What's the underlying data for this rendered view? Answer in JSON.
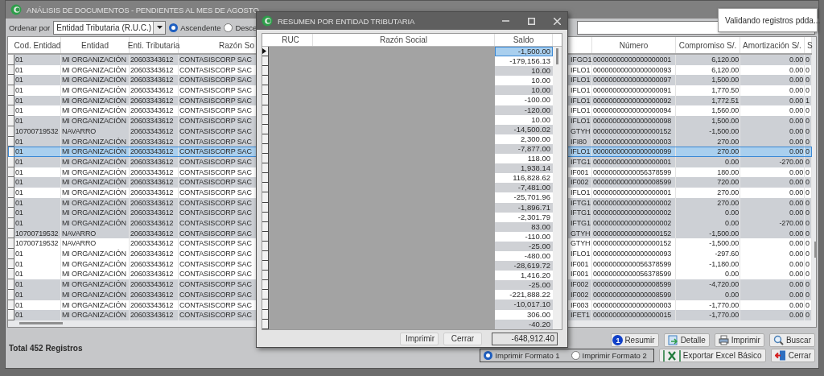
{
  "main_window": {
    "title": "ANÁLISIS DE DOCUMENTOS - PENDIENTES AL MES DE AGOSTO"
  },
  "toolbar": {
    "sort_label": "Ordenar por",
    "sort_select": {
      "value": "Entidad Tributaria (R.U.C.)"
    },
    "order_options": [
      {
        "label": "Ascendente",
        "selected": true
      },
      {
        "label": "Desce",
        "selected": false
      }
    ]
  },
  "toast": {
    "text": "Validando registros pdda..."
  },
  "grid": {
    "headers": {
      "cod_entidad": "Cod. Entidad",
      "entidad": "Entidad",
      "enti_tributaria": "Enti. Tributaria",
      "razon_social": "Razón So",
      "numero": "Número",
      "compromiso": "Compromiso S/.",
      "amortizacion": "Amortización S/.",
      "column_9": "S"
    },
    "rows": [
      {
        "cod_entidad": "01",
        "entidad": "MI ORGANIZACIÓN",
        "enti_tributaria": "20603343612",
        "razon_social": "CONTASISCORP SAC",
        "column_5": "IFGO1",
        "numero": "00000000000000000001",
        "compromiso": "6,120.00",
        "amortizacion": "0.00",
        "column_9": "0",
        "shaded": true,
        "selected": false
      },
      {
        "cod_entidad": "01",
        "entidad": "MI ORGANIZACIÓN",
        "enti_tributaria": "20603343612",
        "razon_social": "CONTASISCORP SAC",
        "column_5": "IFLO1",
        "numero": "00000000000000000093",
        "compromiso": "6,120.00",
        "amortizacion": "0.00",
        "column_9": "0",
        "shaded": false,
        "selected": false
      },
      {
        "cod_entidad": "01",
        "entidad": "MI ORGANIZACIÓN",
        "enti_tributaria": "20603343612",
        "razon_social": "CONTASISCORP SAC",
        "column_5": "IFLO1",
        "numero": "00000000000000000097",
        "compromiso": "1,500.00",
        "amortizacion": "0.00",
        "column_9": "0",
        "shaded": true,
        "selected": false
      },
      {
        "cod_entidad": "01",
        "entidad": "MI ORGANIZACIÓN",
        "enti_tributaria": "20603343612",
        "razon_social": "CONTASISCORP SAC",
        "column_5": "IFLO1",
        "numero": "00000000000000000091",
        "compromiso": "1,770.50",
        "amortizacion": "0.00",
        "column_9": "0",
        "shaded": false,
        "selected": false
      },
      {
        "cod_entidad": "01",
        "entidad": "MI ORGANIZACIÓN",
        "enti_tributaria": "20603343612",
        "razon_social": "CONTASISCORP SAC",
        "column_5": "IFLO1",
        "numero": "00000000000000000092",
        "compromiso": "1,772.51",
        "amortizacion": "0.00",
        "column_9": "1",
        "shaded": true,
        "selected": false
      },
      {
        "cod_entidad": "01",
        "entidad": "MI ORGANIZACIÓN",
        "enti_tributaria": "20603343612",
        "razon_social": "CONTASISCORP SAC",
        "column_5": "IFLO1",
        "numero": "00000000000000000094",
        "compromiso": "1,560.00",
        "amortizacion": "0.00",
        "column_9": "0",
        "shaded": false,
        "selected": false
      },
      {
        "cod_entidad": "01",
        "entidad": "MI ORGANIZACIÓN",
        "enti_tributaria": "20603343612",
        "razon_social": "CONTASISCORP SAC",
        "column_5": "IFLO1",
        "numero": "00000000000000000098",
        "compromiso": "1,500.00",
        "amortizacion": "0.00",
        "column_9": "0",
        "shaded": true,
        "selected": false
      },
      {
        "cod_entidad": "10700719532",
        "entidad": "NAVARRO",
        "enti_tributaria": "20603343612",
        "razon_social": "CONTASISCORP SAC",
        "column_5": "GTYH",
        "numero": "00000000000000000152",
        "compromiso": "-1,500.00",
        "amortizacion": "0.00",
        "column_9": "0",
        "shaded": true,
        "selected": false
      },
      {
        "cod_entidad": "01",
        "entidad": "MI ORGANIZACIÓN",
        "enti_tributaria": "20603343612",
        "razon_social": "CONTASISCORP SAC",
        "column_5": "IFI80",
        "numero": "00000000000000000003",
        "compromiso": "270.00",
        "amortizacion": "0.00",
        "column_9": "0",
        "shaded": true,
        "selected": false
      },
      {
        "cod_entidad": "01",
        "entidad": "MI ORGANIZACIÓN",
        "enti_tributaria": "20603343612",
        "razon_social": "CONTASISCORP SAC",
        "column_5": "IFLO1",
        "numero": "00000000000000000099",
        "compromiso": "270.00",
        "amortizacion": "0.00",
        "column_9": "0",
        "shaded": false,
        "selected": true
      },
      {
        "cod_entidad": "01",
        "entidad": "MI ORGANIZACIÓN",
        "enti_tributaria": "20603343612",
        "razon_social": "CONTASISCORP SAC",
        "column_5": "IFTG1",
        "numero": "00000000000000000001",
        "compromiso": "0.00",
        "amortizacion": "-270.00",
        "column_9": "0",
        "shaded": true,
        "selected": false
      },
      {
        "cod_entidad": "01",
        "entidad": "MI ORGANIZACIÓN",
        "enti_tributaria": "20603343612",
        "razon_social": "CONTASISCORP SAC",
        "column_5": "IF001",
        "numero": "00000000000056378599",
        "compromiso": "180.00",
        "amortizacion": "0.00",
        "column_9": "0",
        "shaded": false,
        "selected": false
      },
      {
        "cod_entidad": "01",
        "entidad": "MI ORGANIZACIÓN",
        "enti_tributaria": "20603343612",
        "razon_social": "CONTASISCORP SAC",
        "column_5": "IF002",
        "numero": "00000000000000008599",
        "compromiso": "720.00",
        "amortizacion": "0.00",
        "column_9": "0",
        "shaded": true,
        "selected": false
      },
      {
        "cod_entidad": "01",
        "entidad": "MI ORGANIZACIÓN",
        "enti_tributaria": "20603343612",
        "razon_social": "CONTASISCORP SAC",
        "column_5": "IFLO1",
        "numero": "00000000000000000001",
        "compromiso": "270.00",
        "amortizacion": "0.00",
        "column_9": "0",
        "shaded": false,
        "selected": false
      },
      {
        "cod_entidad": "01",
        "entidad": "MI ORGANIZACIÓN",
        "enti_tributaria": "20603343612",
        "razon_social": "CONTASISCORP SAC",
        "column_5": "IFTG1",
        "numero": "00000000000000000002",
        "compromiso": "270.00",
        "amortizacion": "0.00",
        "column_9": "0",
        "shaded": true,
        "selected": false
      },
      {
        "cod_entidad": "01",
        "entidad": "MI ORGANIZACIÓN",
        "enti_tributaria": "20603343612",
        "razon_social": "CONTASISCORP SAC",
        "column_5": "IFTG1",
        "numero": "00000000000000000002",
        "compromiso": "0.00",
        "amortizacion": "0.00",
        "column_9": "0",
        "shaded": true,
        "selected": false
      },
      {
        "cod_entidad": "01",
        "entidad": "MI ORGANIZACIÓN",
        "enti_tributaria": "20603343612",
        "razon_social": "CONTASISCORP SAC",
        "column_5": "IFTG1",
        "numero": "00000000000000000002",
        "compromiso": "0.00",
        "amortizacion": "-270.00",
        "column_9": "0",
        "shaded": true,
        "selected": false
      },
      {
        "cod_entidad": "10700719532",
        "entidad": "NAVARRO",
        "enti_tributaria": "20603343612",
        "razon_social": "CONTASISCORP SAC",
        "column_5": "GTYH",
        "numero": "00000000000000000152",
        "compromiso": "-1,500.00",
        "amortizacion": "0.00",
        "column_9": "0",
        "shaded": true,
        "selected": false
      },
      {
        "cod_entidad": "10700719532",
        "entidad": "NAVARRO",
        "enti_tributaria": "20603343612",
        "razon_social": "CONTASISCORP SAC",
        "column_5": "GTYH",
        "numero": "00000000000000000152",
        "compromiso": "-1,500.00",
        "amortizacion": "0.00",
        "column_9": "0",
        "shaded": false,
        "selected": false
      },
      {
        "cod_entidad": "01",
        "entidad": "MI ORGANIZACIÓN",
        "enti_tributaria": "20603343612",
        "razon_social": "CONTASISCORP SAC",
        "column_5": "IFLO1",
        "numero": "00000000000000000093",
        "compromiso": "-297.60",
        "amortizacion": "0.00",
        "column_9": "0",
        "shaded": false,
        "selected": false
      },
      {
        "cod_entidad": "01",
        "entidad": "MI ORGANIZACIÓN",
        "enti_tributaria": "20603343612",
        "razon_social": "CONTASISCORP SAC",
        "column_5": "IF001",
        "numero": "00000000000056378599",
        "compromiso": "-1,180.00",
        "amortizacion": "0.00",
        "column_9": "0",
        "shaded": false,
        "selected": false
      },
      {
        "cod_entidad": "01",
        "entidad": "MI ORGANIZACIÓN",
        "enti_tributaria": "20603343612",
        "razon_social": "CONTASISCORP SAC",
        "column_5": "IF001",
        "numero": "00000000000056378599",
        "compromiso": "0.00",
        "amortizacion": "0.00",
        "column_9": "0",
        "shaded": false,
        "selected": false
      },
      {
        "cod_entidad": "01",
        "entidad": "MI ORGANIZACIÓN",
        "enti_tributaria": "20603343612",
        "razon_social": "CONTASISCORP SAC",
        "column_5": "IF002",
        "numero": "00000000000000008599",
        "compromiso": "-4,720.00",
        "amortizacion": "0.00",
        "column_9": "0",
        "shaded": true,
        "selected": false
      },
      {
        "cod_entidad": "01",
        "entidad": "MI ORGANIZACIÓN",
        "enti_tributaria": "20603343612",
        "razon_social": "CONTASISCORP SAC",
        "column_5": "IF002",
        "numero": "00000000000000008599",
        "compromiso": "0.00",
        "amortizacion": "0.00",
        "column_9": "0",
        "shaded": true,
        "selected": false
      },
      {
        "cod_entidad": "01",
        "entidad": "MI ORGANIZACIÓN",
        "enti_tributaria": "20603343612",
        "razon_social": "CONTASISCORP SAC",
        "column_5": "IF003",
        "numero": "00000000000000000003",
        "compromiso": "-1,770.00",
        "amortizacion": "0.00",
        "column_9": "0",
        "shaded": false,
        "selected": false
      },
      {
        "cod_entidad": "01",
        "entidad": "MI ORGANIZACIÓN",
        "enti_tributaria": "20603343612",
        "razon_social": "CONTASISCORP SAC",
        "column_5": "IFET1",
        "numero": "00000000000000000015",
        "compromiso": "-1,770.00",
        "amortizacion": "0.00",
        "column_9": "0",
        "shaded": true,
        "selected": false
      }
    ]
  },
  "footer": {
    "total": "Total 452 Registros",
    "buttons": [
      {
        "label": "Resumir",
        "badge": "1"
      },
      {
        "label": "Detalle"
      },
      {
        "label": "Imprimir"
      },
      {
        "label": "Buscar"
      }
    ],
    "print_formats": [
      {
        "label": "Imprimir Formato 1",
        "selected": true
      },
      {
        "label": "Imprimir Formato 2",
        "selected": false
      }
    ],
    "buttons_2": [
      {
        "label": "Exportar Excel Básico"
      },
      {
        "label": "Cerrar"
      }
    ]
  },
  "dialog": {
    "title": "RESUMEN POR ENTIDAD TRIBUTARIA",
    "columns": [
      "RUC",
      "Razón Social",
      "Saldo"
    ],
    "rows": [
      {
        "saldo": "-1,500.00",
        "selected": true
      },
      {
        "saldo": "-179,156.13",
        "selected": false
      },
      {
        "saldo": "10.00",
        "selected": false
      },
      {
        "saldo": "10.00",
        "selected": false
      },
      {
        "saldo": "10.00",
        "selected": false
      },
      {
        "saldo": "-100.00",
        "selected": false
      },
      {
        "saldo": "-120.00",
        "selected": false
      },
      {
        "saldo": "10.00",
        "selected": false
      },
      {
        "saldo": "-14,500.02",
        "selected": false
      },
      {
        "saldo": "2,300.00",
        "selected": false
      },
      {
        "saldo": "-7,877.00",
        "selected": false
      },
      {
        "saldo": "118.00",
        "selected": false
      },
      {
        "saldo": "1,938.14",
        "selected": false
      },
      {
        "saldo": "116,828.62",
        "selected": false
      },
      {
        "saldo": "-7,481.00",
        "selected": false
      },
      {
        "saldo": "-25,701.96",
        "selected": false
      },
      {
        "saldo": "-1,896.71",
        "selected": false
      },
      {
        "saldo": "-2,301.79",
        "selected": false
      },
      {
        "saldo": "83.00",
        "selected": false
      },
      {
        "saldo": "-110.00",
        "selected": false
      },
      {
        "saldo": "-25.00",
        "selected": false
      },
      {
        "saldo": "-480.00",
        "selected": false
      },
      {
        "saldo": "-28,619.72",
        "selected": false
      },
      {
        "saldo": "1,416.20",
        "selected": false
      },
      {
        "saldo": "-25.00",
        "selected": false
      },
      {
        "saldo": "-221,888.22",
        "selected": false
      },
      {
        "saldo": "-10,017.10",
        "selected": false
      },
      {
        "saldo": "306.00",
        "selected": false
      },
      {
        "saldo": "-40.20",
        "selected": false
      }
    ],
    "buttons": [
      {
        "label": "Imprimir"
      },
      {
        "label": "Cerrar"
      }
    ],
    "total": "-648,912.40"
  }
}
